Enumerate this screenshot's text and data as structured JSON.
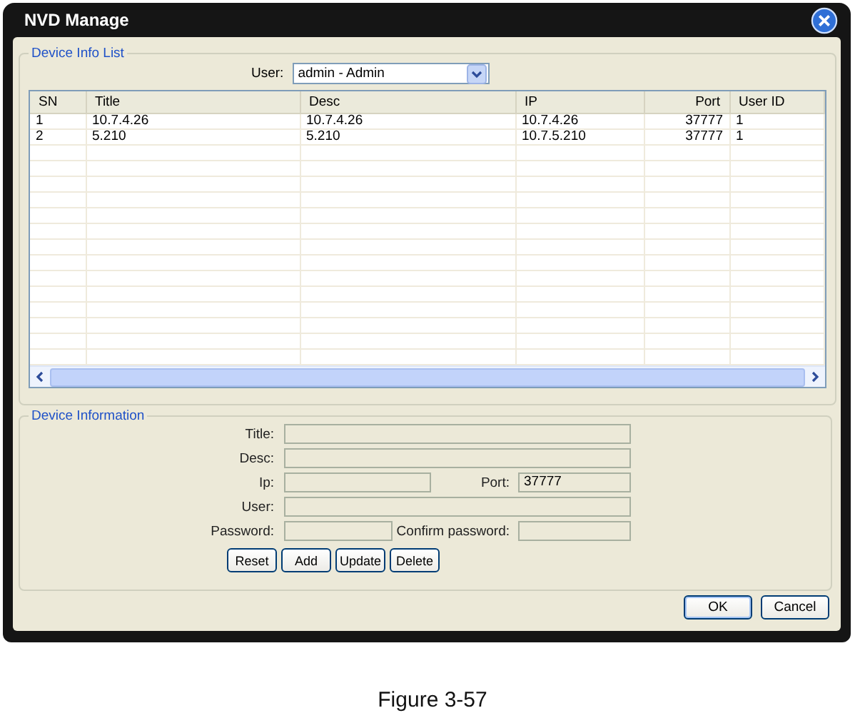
{
  "window": {
    "title": "NVD Manage"
  },
  "device_info_list": {
    "legend": "Device Info List",
    "user_label": "User:",
    "user_value": "admin - Admin",
    "columns": [
      "SN",
      "Title",
      "Desc",
      "IP",
      "Port",
      "User ID"
    ],
    "rows": [
      {
        "sn": "1",
        "title": "10.7.4.26",
        "desc": "10.7.4.26",
        "ip": "10.7.4.26",
        "port": "37777",
        "user_id": "1"
      },
      {
        "sn": "2",
        "title": "5.210",
        "desc": "5.210",
        "ip": "10.7.5.210",
        "port": "37777",
        "user_id": "1"
      }
    ]
  },
  "device_information": {
    "legend": "Device Information",
    "title_label": "Title:",
    "desc_label": "Desc:",
    "ip_label": "Ip:",
    "port_label": "Port:",
    "port_value": "37777",
    "user_label": "User:",
    "password_label": "Password:",
    "confirm_label": "Confirm password:",
    "buttons": [
      "Reset",
      "Add",
      "Update",
      "Delete"
    ]
  },
  "dialog_buttons": [
    "OK",
    "Cancel"
  ],
  "caption": "Figure 3-57"
}
